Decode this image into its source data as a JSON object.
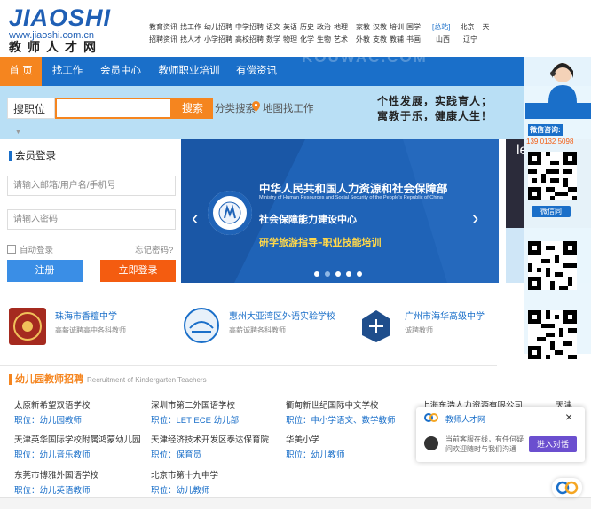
{
  "logo": {
    "main": "JIAOSHI",
    "url": "www.jiaoshi.com.cn",
    "cn": "教师人才网"
  },
  "toplinks": {
    "row1": [
      "教育资讯",
      "找工作",
      "幼儿招聘",
      "中学招聘",
      "语文",
      "英语",
      "历史",
      "政治",
      "地理",
      "家教",
      "汉教",
      "培训",
      "国学",
      "[总站]",
      "北京",
      "天"
    ],
    "row2": [
      "招聘资讯",
      "找人才",
      "小学招聘",
      "高校招聘",
      "数学",
      "物理",
      "化学",
      "生物",
      "艺术",
      "外教",
      "支教",
      "教辅",
      "书画",
      "山西",
      "辽宁"
    ]
  },
  "nav": [
    "首 页",
    "找工作",
    "会员中心",
    "教师职业培训",
    "有偿资讯"
  ],
  "watermark": "KOUWAC.COM",
  "search": {
    "select": "搜职位",
    "button": "搜索",
    "links": [
      "分类搜索",
      "地图找工作"
    ]
  },
  "slogan": [
    "个性发展，实践育人；",
    "寓教于乐，健康人生！"
  ],
  "login": {
    "title": "会员登录",
    "user_placeholder": "请输入邮箱/用户名/手机号",
    "pass_placeholder": "请输入密码",
    "auto": "自动登录",
    "forgot": "忘记密码?",
    "register": "注册",
    "submit": "立即登录"
  },
  "banner": {
    "ministry_cn": "中华人民共和国人力资源和社会保障部",
    "ministry_en": "Ministry of Human Resources and Social Security of the People's Republic of China",
    "center": "社会保障能力建设中心",
    "program": "研学旅游指导–职业技能培训",
    "seal_text": "人力资源社会保障部社会保障能力建设中心"
  },
  "side": {
    "title": "微信咨询:",
    "phone": "139 0132 5098",
    "btn": "微信同",
    "partial": "le"
  },
  "schools": [
    {
      "name": "珠海市香檀中学",
      "desc": "高薪诚聘高中各科教师"
    },
    {
      "name": "惠州大亚湾区外语实验学校",
      "desc": "高薪诚聘各科教师"
    },
    {
      "name": "广州市海华高级中学",
      "desc": "诚聘教师"
    }
  ],
  "kinder": {
    "title": "幼儿园教师招聘",
    "subtitle": "Recruitment of Kindergarten Teachers",
    "items": [
      {
        "name": "太原新希望双语学校",
        "job": "职位：幼儿园教师"
      },
      {
        "name": "深圳市第二外国语学校",
        "job": "职位：LET ECE 幼儿部"
      },
      {
        "name": "衢甸新世纪国际中文学校",
        "job": "职位：中小学语文、数学教师"
      },
      {
        "name": "上海东浩人力资源有限公司",
        "job": ""
      },
      {
        "name": "天津英华国际学校附属鸿蒙幼儿园",
        "job": "职位：幼儿音乐教师"
      },
      {
        "name": "天津经济技术开发区泰达保育院",
        "job": "职位：保育员"
      },
      {
        "name": "华美小学",
        "job": "职位：幼儿教师"
      },
      {
        "name": "东莞市博雅外国语学校",
        "job": "职位：幼儿英语教师"
      },
      {
        "name": "北京市第十九中学",
        "job": "职位：幼儿教师"
      }
    ],
    "cut1": "天津",
    "cut2": "职位"
  },
  "chat": {
    "name": "教师人才网",
    "msg1": "当前客服在线，有任何疑",
    "msg2": "问欢迎随时与我们沟通",
    "btn": "进入对话",
    "close": "×"
  },
  "colors": {
    "primary": "#1a6fc9",
    "accent": "#f5851f",
    "banner": "#1f63b7",
    "chatbtn": "#6b4fcf"
  }
}
